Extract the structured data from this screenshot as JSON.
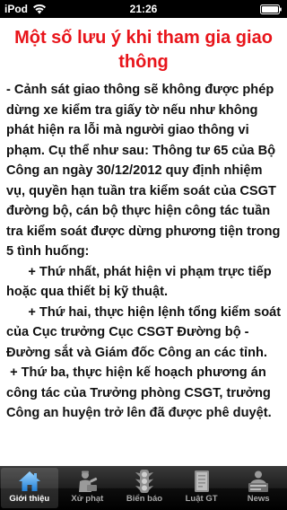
{
  "status_bar": {
    "carrier": "iPod",
    "time": "21:26",
    "wifi_icon": "wifi-icon",
    "battery_icon": "battery-icon"
  },
  "main": {
    "title": "Một số lưu ý khi tham gia giao thông",
    "body": "- Cảnh sát giao thông sẽ không được phép dừng xe kiểm tra giấy tờ nếu như không phát hiện ra lỗi mà người giao thông vi phạm. Cụ thể như sau: Thông tư 65 của Bộ Công an ngày 30/12/2012 quy định nhiệm vụ, quyền hạn tuần tra kiểm soát của CSGT đường bộ, cán bộ thực hiện công tác tuần tra kiểm soát được dừng phương tiện trong 5 tình huống:\n      + Thứ nhất, phát hiện vi phạm trực tiếp hoặc qua thiết bị kỹ thuật.\n      + Thứ hai, thực hiện lệnh tổng kiểm soát của Cục trưởng Cục CSGT Đường bộ - Đường sắt và Giám đốc Công an các tỉnh.\n + Thứ ba, thực hiện kế hoạch phương án công tác của Trưởng phòng CSGT, trưởng Công an huyện trở lên đã được phê duyệt."
  },
  "tab_bar": {
    "active_color": "#ffffff",
    "inactive_color": "#a9a9a9",
    "tabs": [
      {
        "label": "Giới thiệu",
        "icon": "home-icon"
      },
      {
        "label": "Xử phạt",
        "icon": "traffic-police-icon"
      },
      {
        "label": "Biển báo",
        "icon": "traffic-light-icon"
      },
      {
        "label": "Luật GT",
        "icon": "law-book-icon"
      },
      {
        "label": "News",
        "icon": "news-icon"
      }
    ]
  }
}
